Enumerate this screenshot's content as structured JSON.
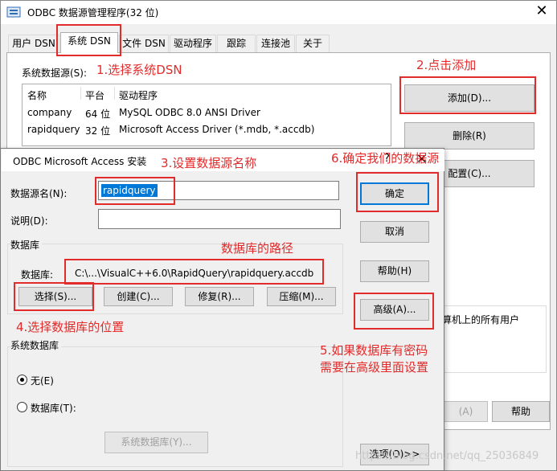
{
  "window": {
    "title": "ODBC 数据源管理程序(32 位)",
    "close": "✕"
  },
  "tabs": [
    {
      "label": "用户 DSN"
    },
    {
      "label": "系统 DSN"
    },
    {
      "label": "文件 DSN"
    },
    {
      "label": "驱动程序"
    },
    {
      "label": "跟踪"
    },
    {
      "label": "连接池"
    },
    {
      "label": "关于"
    }
  ],
  "system_dsn": {
    "list_label": "系统数据源(S):",
    "columns": [
      "名称",
      "平台",
      "驱动程序"
    ],
    "rows": [
      {
        "name": "company",
        "platform": "64 位",
        "driver": "MySQL ODBC 8.0 ANSI Driver"
      },
      {
        "name": "rapidquery",
        "platform": "32 位",
        "driver": "Microsoft Access Driver (*.mdb, *.accdb)"
      }
    ],
    "add_button": "添加(D)...",
    "remove_button": "删除(R)",
    "config_button": "配置(C)...",
    "info_text": "算机上的所有用户",
    "apply_button": "(A)",
    "help_button": "帮助"
  },
  "dialog": {
    "title": "ODBC Microsoft Access 安装",
    "help_glyph": "?",
    "close": "✕",
    "dsn_label": "数据源名(N):",
    "dsn_value": "rapidquery",
    "desc_label": "说明(D):",
    "desc_value": "",
    "database_group": "数据库",
    "db_path_label": "数据库:",
    "db_path_value": "C:\\...\\VisualC++6.0\\RapidQuery\\rapidquery.accdb",
    "btn_select": "选择(S)...",
    "btn_create": "创建(C)...",
    "btn_repair": "修复(R)...",
    "btn_compact": "压缩(M)...",
    "system_db_group": "系统数据库",
    "radio_none": "无(E)",
    "radio_database": "数据库(T):",
    "btn_system_db": "系统数据库(Y)...",
    "btn_ok": "确定",
    "btn_cancel": "取消",
    "btn_help": "帮助(H)",
    "btn_advanced": "高级(A)...",
    "btn_options": "选项(O)>>"
  },
  "annotations": {
    "step1": "1.选择系统DSN",
    "step2": "2.点击添加",
    "step3": "3.设置数据源名称",
    "db_path_note": "数据库的路径",
    "step4": "4.选择数据库的位置",
    "step5_line1": "5.如果数据库有密码",
    "step5_line2": "需要在高级里面设置",
    "step6": "6.确定我们的数据源",
    "color": "#e22b2b"
  },
  "watermark": "https://blog.csdn.net/qq_25036849"
}
